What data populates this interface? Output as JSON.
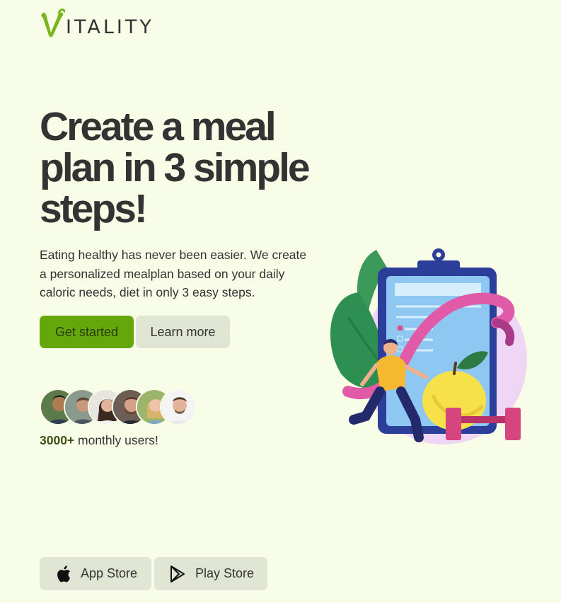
{
  "brand": {
    "logo_letter": "V",
    "logo_text": "ITALITY",
    "accent_color": "#64a70b"
  },
  "hero": {
    "title": "Create a meal plan in 3 simple steps!",
    "description": "Eating healthy has never been easier. We create a personalized mealplan based on your daily caloric needs, diet in only 3 easy steps.",
    "primary_button": "Get started",
    "secondary_button": "Learn more"
  },
  "social_proof": {
    "avatars": [
      "avatar-1",
      "avatar-2",
      "avatar-3",
      "avatar-4",
      "avatar-5",
      "avatar-6"
    ],
    "count": "3000+",
    "label": " monthly users!"
  },
  "stores": {
    "app_store": "App Store",
    "play_store": "Play Store",
    "app_store_icon": "apple-icon",
    "play_store_icon": "play-store-icon"
  },
  "illustration": {
    "icon": "meal-plan-clipboard-illustration"
  }
}
